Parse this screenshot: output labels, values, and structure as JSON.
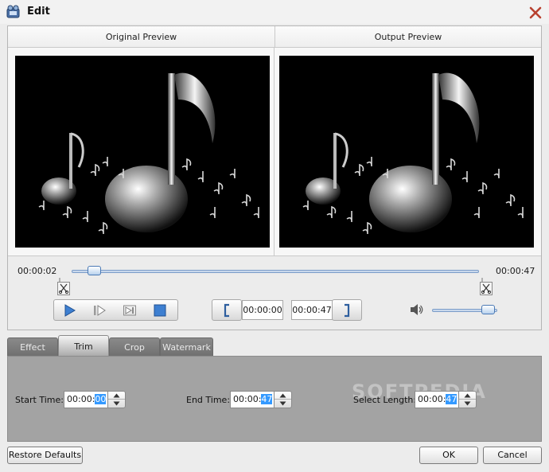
{
  "window": {
    "title": "Edit"
  },
  "preview": {
    "original_label": "Original Preview",
    "output_label": "Output Preview"
  },
  "playback": {
    "current_time": "00:00:02",
    "total_time": "00:00:47",
    "progress_fraction": 0.04,
    "mark_in_time": "00:00:00",
    "mark_out_time": "00:00:47",
    "volume_fraction": 0.95,
    "icons": [
      "play-icon",
      "next-frame-icon",
      "skip-end-icon",
      "stop-icon",
      "scissors-icon",
      "speaker-icon"
    ]
  },
  "tabs": [
    {
      "label": "Effect",
      "active": false
    },
    {
      "label": "Trim",
      "active": true
    },
    {
      "label": "Crop",
      "active": false
    },
    {
      "label": "Watermark",
      "active": false
    }
  ],
  "trim": {
    "start_label": "Start Time:",
    "start_prefix": "00:00:",
    "start_selected": "00",
    "end_label": "End Time:",
    "end_prefix": "00:00:",
    "end_selected": "47",
    "length_label": "Select Length:",
    "length_prefix": "00:00:",
    "length_selected": "47"
  },
  "watermark_text": "SOFTPEDIA",
  "buttons": {
    "restore": "Restore Defaults",
    "ok": "OK",
    "cancel": "Cancel"
  }
}
